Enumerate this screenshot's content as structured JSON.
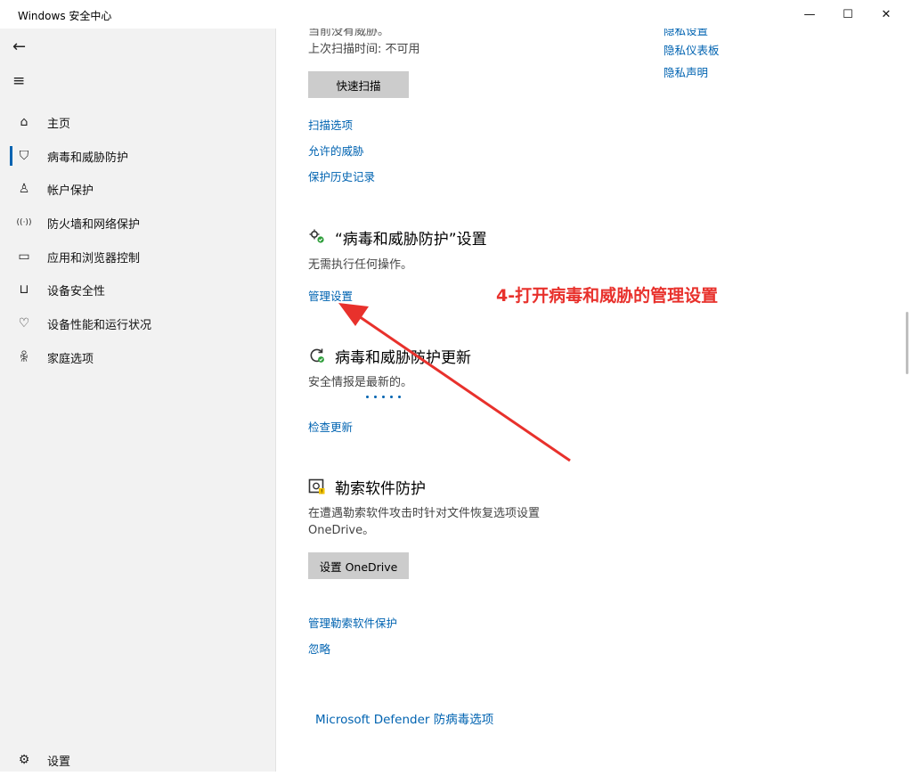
{
  "window": {
    "title": "Windows 安全中心",
    "minimize_glyph": "—",
    "maximize_glyph": "☐",
    "close_glyph": "✕"
  },
  "sidebar": {
    "back_glyph": "←",
    "menu_glyph": "≡",
    "items": [
      {
        "label": "主页",
        "icon": "home-icon",
        "glyph": "⌂"
      },
      {
        "label": "病毒和威胁防护",
        "icon": "shield-icon",
        "glyph": "⛉",
        "active": true
      },
      {
        "label": "帐户保护",
        "icon": "person-icon",
        "glyph": "♙"
      },
      {
        "label": "防火墙和网络保护",
        "icon": "wifi-icon",
        "glyph": "((·))"
      },
      {
        "label": "应用和浏览器控制",
        "icon": "browser-window-icon",
        "glyph": "▭"
      },
      {
        "label": "设备安全性",
        "icon": "laptop-icon",
        "glyph": "⊔"
      },
      {
        "label": "设备性能和运行状况",
        "icon": "heart-icon",
        "glyph": "♡"
      },
      {
        "label": "家庭选项",
        "icon": "family-icon",
        "glyph": "ꆜ"
      }
    ],
    "settings": {
      "label": "设置",
      "icon": "gear-icon",
      "glyph": "⚙"
    }
  },
  "content": {
    "threats_line_partial": "当前没有威胁。",
    "last_scan": "上次扫描时间: 不可用",
    "quick_scan_button": "快速扫描",
    "links_1": [
      "扫描选项",
      "允许的威胁",
      "保护历史记录"
    ],
    "right_links": [
      "隐私设置",
      "隐私仪表板",
      "隐私声明"
    ],
    "settings_section": {
      "title": "“病毒和威胁防护”设置",
      "desc": "无需执行任何操作。",
      "link": "管理设置"
    },
    "update_section": {
      "title": "病毒和威胁防护更新",
      "desc": "安全情报是最新的。",
      "link": "检查更新"
    },
    "ransomware_section": {
      "title": "勒索软件防护",
      "desc_line1": "在遭遇勒索软件攻击时针对文件恢复选项设置",
      "desc_line2": "OneDrive。",
      "button": "设置 OneDrive",
      "links": [
        "管理勒索软件保护",
        "忽略"
      ]
    },
    "defender_link": "Microsoft Defender 防病毒选项"
  },
  "annotation": {
    "text": "4-打开病毒和威胁的管理设置",
    "color": "#e8312c"
  },
  "colors": {
    "accent": "#0063b1",
    "sidebar_bg": "#f2f2f2",
    "button_bg": "#cccccc",
    "annotation": "#e8312c"
  }
}
